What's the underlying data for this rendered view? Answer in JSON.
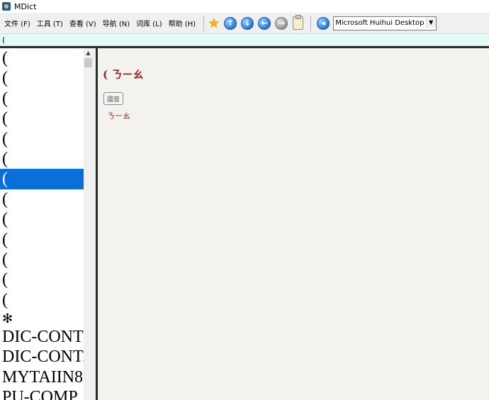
{
  "window": {
    "title": "MDict"
  },
  "menu": [
    "文件 (F)",
    "工具 (T)",
    "查看 (V)",
    "导航 (N)",
    "词库 (L)",
    "帮助 (H)"
  ],
  "toolbar": {
    "icons": [
      "star-icon",
      "up-icon",
      "down-icon",
      "back-icon",
      "forward-icon",
      "clipboard-icon",
      "prev-dict-icon"
    ],
    "font_select": "Microsoft Huihui Desktop - C"
  },
  "search": {
    "value": "("
  },
  "word_list": {
    "items": [
      "(",
      "(",
      "(",
      "(",
      "(",
      "(",
      "(",
      "(",
      "(",
      "(",
      "(",
      "(",
      "(",
      "✻",
      "DIC-CONT",
      "DIC-CONT.",
      "MYTAIIN8",
      "PU-COMP"
    ],
    "selected_index": 6
  },
  "entry": {
    "headword": "( ㄋㄧㄠ",
    "audio_label": "國音",
    "pronunciation": "ㄋㄧㄠ"
  }
}
